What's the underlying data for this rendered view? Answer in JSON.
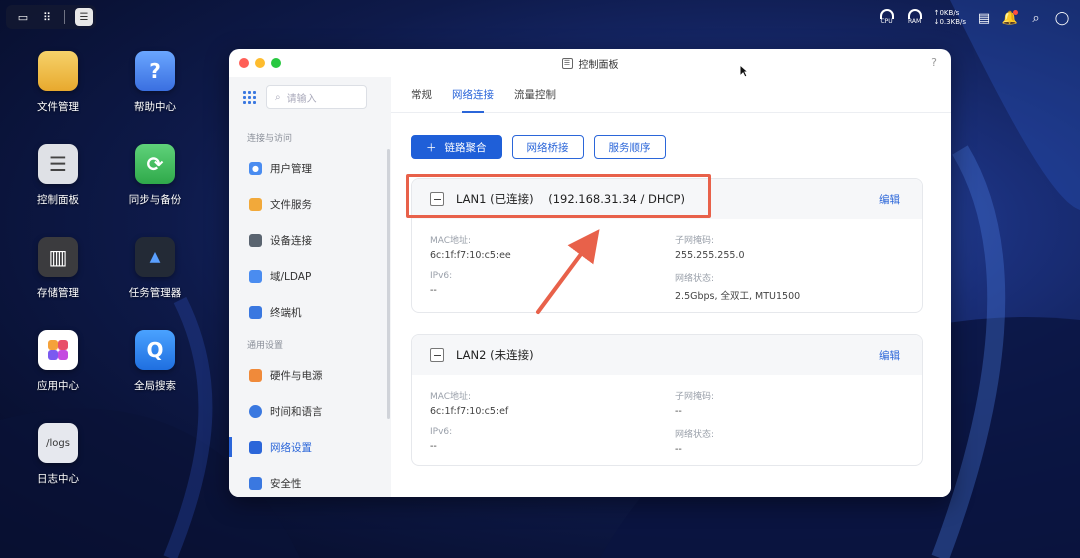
{
  "topbar": {
    "cpu_label": "CPU",
    "ram_label": "RAM",
    "upload_speed": "0KB/s",
    "download_speed": "0.3KB/s"
  },
  "desktop": {
    "icons": [
      {
        "label": "文件管理",
        "color": "#f2c44a"
      },
      {
        "label": "帮助中心",
        "color": "#4a8cf0"
      },
      {
        "label": "控制面板",
        "color": "#d9dbe0"
      },
      {
        "label": "同步与备份",
        "color": "#3fbf5a"
      },
      {
        "label": "存储管理",
        "color": "#3a3a3a"
      },
      {
        "label": "任务管理器",
        "color": "#222834"
      },
      {
        "label": "应用中心",
        "color": "#ffffff"
      },
      {
        "label": "全局搜索",
        "color": "#2f8cf2"
      },
      {
        "label": "日志中心",
        "color": "#e6e8ee",
        "tile_text": "/logs"
      }
    ]
  },
  "window": {
    "title": "控制面板",
    "help": "?"
  },
  "sidebar": {
    "search_placeholder": "请输入",
    "groups": [
      {
        "label": "连接与访问"
      },
      {
        "label": "通用设置"
      }
    ],
    "items": [
      {
        "label": "用户管理",
        "color": "#4a8cf0"
      },
      {
        "label": "文件服务",
        "color": "#f2a93a"
      },
      {
        "label": "设备连接",
        "color": "#5a6470"
      },
      {
        "label": "域/LDAP",
        "color": "#4a8cf0"
      },
      {
        "label": "终端机",
        "color": "#3a78e0"
      },
      {
        "label": "硬件与电源",
        "color": "#f08a3a"
      },
      {
        "label": "时间和语言",
        "color": "#3a78e0"
      },
      {
        "label": "网络设置",
        "color": "#2b66d9"
      },
      {
        "label": "安全性",
        "color": "#3a78e0"
      }
    ]
  },
  "tabs": [
    {
      "label": "常规"
    },
    {
      "label": "网络连接"
    },
    {
      "label": "流量控制"
    }
  ],
  "buttons": {
    "link_aggregation": "链路聚合",
    "bridge": "网络桥接",
    "service_order": "服务顺序"
  },
  "lan1": {
    "title": "LAN1 (已连接)    (192.168.31.34 / DHCP)",
    "edit": "编辑",
    "mac_label": "MAC地址:",
    "mac_value": "6c:1f:f7:10:c5:ee",
    "mask_label": "子网掩码:",
    "mask_value": "255.255.255.0",
    "ipv6_label": "IPv6:",
    "ipv6_value": "--",
    "status_label": "网络状态:",
    "status_value": "2.5Gbps, 全双工, MTU1500"
  },
  "lan2": {
    "title": "LAN2 (未连接)",
    "edit": "编辑",
    "mac_label": "MAC地址:",
    "mac_value": "6c:1f:f7:10:c5:ef",
    "mask_label": "子网掩码:",
    "mask_value": "--",
    "ipv6_label": "IPv6:",
    "ipv6_value": "--",
    "status_label": "网络状态:",
    "status_value": "--"
  }
}
